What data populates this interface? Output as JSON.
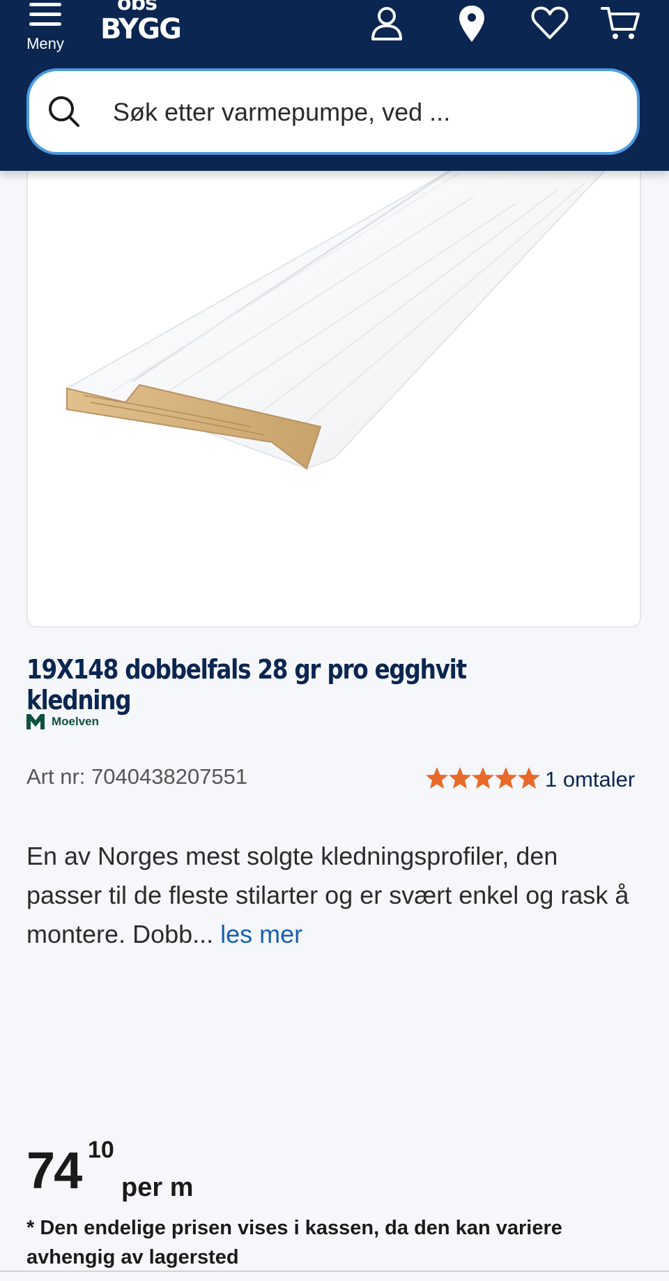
{
  "header": {
    "menu_label": "Meny",
    "logo_top": "obs",
    "logo_bottom": "BYGG",
    "search_placeholder": "Søk etter varmepumpe, ved ..."
  },
  "product": {
    "title": "19X148 dobbelfals 28 gr pro egghvit kledning",
    "brand": "Moelven",
    "art_nr": "Art nr: 7040438207551",
    "rating": 5,
    "reviews": "1 omtaler",
    "description": "En av Norges mest solgte kledningsprofiler, den passer til de fleste stilarter og er svært enkel og rask å montere. Dobb...",
    "read_more": "les mer"
  },
  "price": {
    "integer": "74",
    "decimal": "10",
    "unit": "per m",
    "note": "* Den endelige prisen vises i kassen, da den kan variere avhengig av lagersted"
  },
  "colors": {
    "header_bg": "#0a2651",
    "search_border": "#4c9be0",
    "link": "#1760b0",
    "star": "#e8692a"
  }
}
